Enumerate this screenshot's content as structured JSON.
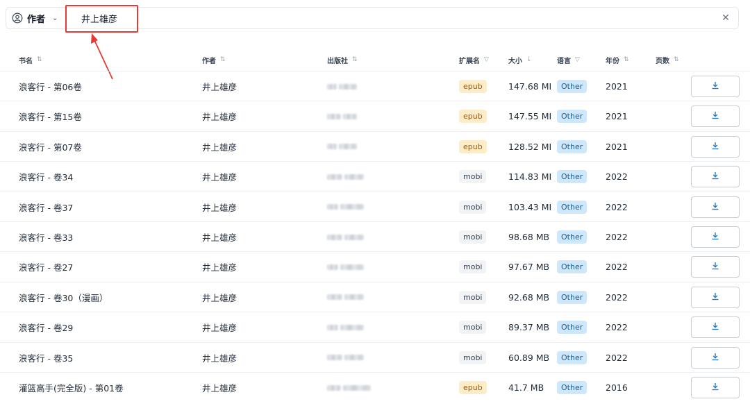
{
  "search": {
    "field_label": "作者",
    "field_icon": "user-circle-icon",
    "value": "井上雄彦",
    "clear_icon": "close-icon"
  },
  "columns": [
    {
      "label": "书名",
      "sort": "⇅"
    },
    {
      "label": "作者",
      "sort": "⇅"
    },
    {
      "label": "出版社",
      "sort": "⇅"
    },
    {
      "label": "扩展名",
      "sort": "▽"
    },
    {
      "label": "大小",
      "sort": "↓"
    },
    {
      "label": "语言",
      "sort": "▽"
    },
    {
      "label": "年份",
      "sort": "⇅"
    },
    {
      "label": "页数",
      "sort": "⇅"
    }
  ],
  "rows": [
    {
      "title": "浪客行 - 第06卷",
      "author": "井上雄彦",
      "ext": "epub",
      "size": "147.68 MI",
      "lang": "Other",
      "year": "2021"
    },
    {
      "title": "浪客行 - 第15卷",
      "author": "井上雄彦",
      "ext": "epub",
      "size": "147.55 MI",
      "lang": "Other",
      "year": "2021"
    },
    {
      "title": "浪客行 - 第07卷",
      "author": "井上雄彦",
      "ext": "epub",
      "size": "128.52 MI",
      "lang": "Other",
      "year": "2021"
    },
    {
      "title": "浪客行 - 卷34",
      "author": "井上雄彦",
      "ext": "mobi",
      "size": "114.83 MI",
      "lang": "Other",
      "year": "2022"
    },
    {
      "title": "浪客行 - 卷37",
      "author": "井上雄彦",
      "ext": "mobi",
      "size": "103.43 MI",
      "lang": "Other",
      "year": "2022"
    },
    {
      "title": "浪客行 - 卷33",
      "author": "井上雄彦",
      "ext": "mobi",
      "size": "98.68 MB",
      "lang": "Other",
      "year": "2022"
    },
    {
      "title": "浪客行 - 卷27",
      "author": "井上雄彦",
      "ext": "mobi",
      "size": "97.67 MB",
      "lang": "Other",
      "year": "2022"
    },
    {
      "title": "浪客行 - 卷30（漫画）",
      "author": "井上雄彦",
      "ext": "mobi",
      "size": "92.68 MB",
      "lang": "Other",
      "year": "2022"
    },
    {
      "title": "浪客行 - 卷29",
      "author": "井上雄彦",
      "ext": "mobi",
      "size": "89.37 MB",
      "lang": "Other",
      "year": "2022"
    },
    {
      "title": "浪客行 - 卷35",
      "author": "井上雄彦",
      "ext": "mobi",
      "size": "60.89 MB",
      "lang": "Other",
      "year": "2022"
    },
    {
      "title": "灌篮高手(完全版) - 第01卷",
      "author": "井上雄彦",
      "ext": "epub",
      "size": "41.7 MB",
      "lang": "Other",
      "year": "2016"
    }
  ],
  "colors": {
    "annotation": "#e53935",
    "epub_badge_bg": "#fdecc8",
    "mobi_badge_bg": "#f1f3f5",
    "lang_badge_bg": "#cfe7fb",
    "download_icon": "#2b7bbf"
  }
}
